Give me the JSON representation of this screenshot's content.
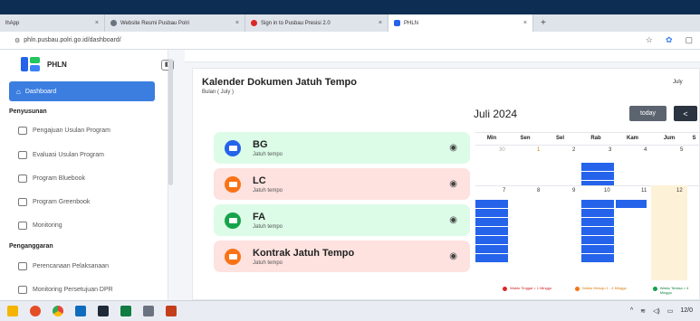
{
  "browser": {
    "tabs": [
      {
        "label": "lhApp",
        "active": false,
        "color": "#888888"
      },
      {
        "label": "Website Resmi Pusbau Polri",
        "active": false,
        "color": "#6b7280"
      },
      {
        "label": "Sign in to Pusbau Presisi 2.0",
        "active": false,
        "color": "#dc2626"
      },
      {
        "label": "PHLN",
        "active": true,
        "color": "#2563eb"
      }
    ],
    "new_tab": "+",
    "close_glyph": "×",
    "url": "phln.pusbau.polri.go.id/dashboard/"
  },
  "sidebar": {
    "app_name": "PHLN",
    "collapse_glyph": "◧",
    "active_item": "Dashboard",
    "section_1": "Penyusunan",
    "items_1": [
      "Pengajuan Usulan Program",
      "Evaluasi Usulan Program",
      "Program Bluebook",
      "Program Greenbook",
      "Monitoring"
    ],
    "section_2": "Penganggaran",
    "items_2": [
      "Perencanaan Pelaksanaan",
      "Monitoring Persetujuan DPR"
    ]
  },
  "main": {
    "title": "Kalender Dokumen Jatuh Tempo",
    "subtitle": "Bulan ( July )",
    "month_select": "July",
    "documents": [
      {
        "name": "BG",
        "status": "Jatuh tempo",
        "bg": "#dcfce7",
        "icon_color": "#2563eb"
      },
      {
        "name": "LC",
        "status": "Jatuh tempo",
        "bg": "#fde2df",
        "icon_color": "#f97316"
      },
      {
        "name": "FA",
        "status": "Jatuh tempo",
        "bg": "#dcfce7",
        "icon_color": "#16a34a"
      },
      {
        "name": "Kontrak Jatuh Tempo",
        "status": "Jatuh tempo",
        "bg": "#fde2df",
        "icon_color": "#f97316"
      }
    ],
    "eye_glyph": "◉"
  },
  "calendar": {
    "month_title": "Juli 2024",
    "today_label": "today",
    "prev_label": "<",
    "weekdays": [
      "Min",
      "Sen",
      "Sel",
      "Rab",
      "Kam",
      "Jum",
      "S"
    ],
    "week1": [
      "30",
      "1",
      "2",
      "3",
      "4",
      "5",
      ""
    ],
    "week2": [
      "7",
      "8",
      "9",
      "10",
      "11",
      "12",
      ""
    ],
    "legend": [
      {
        "label": "Waktu Tinggal < 1 Minggu",
        "color": "#dc2626"
      },
      {
        "label": "Waktu Menuju 1 - 4 Minggu",
        "color": "#f97316"
      },
      {
        "label": "Waktu Tersisa > 4 Minggu",
        "color": "#16a34a"
      }
    ]
  },
  "taskbar": {
    "icons": [
      "explorer-icon",
      "app-icon",
      "chrome-icon",
      "mail-icon",
      "terminal-icon",
      "excel-icon",
      "files-icon",
      "powerpoint-icon"
    ],
    "tray_caret": "^",
    "date": "12/0"
  }
}
